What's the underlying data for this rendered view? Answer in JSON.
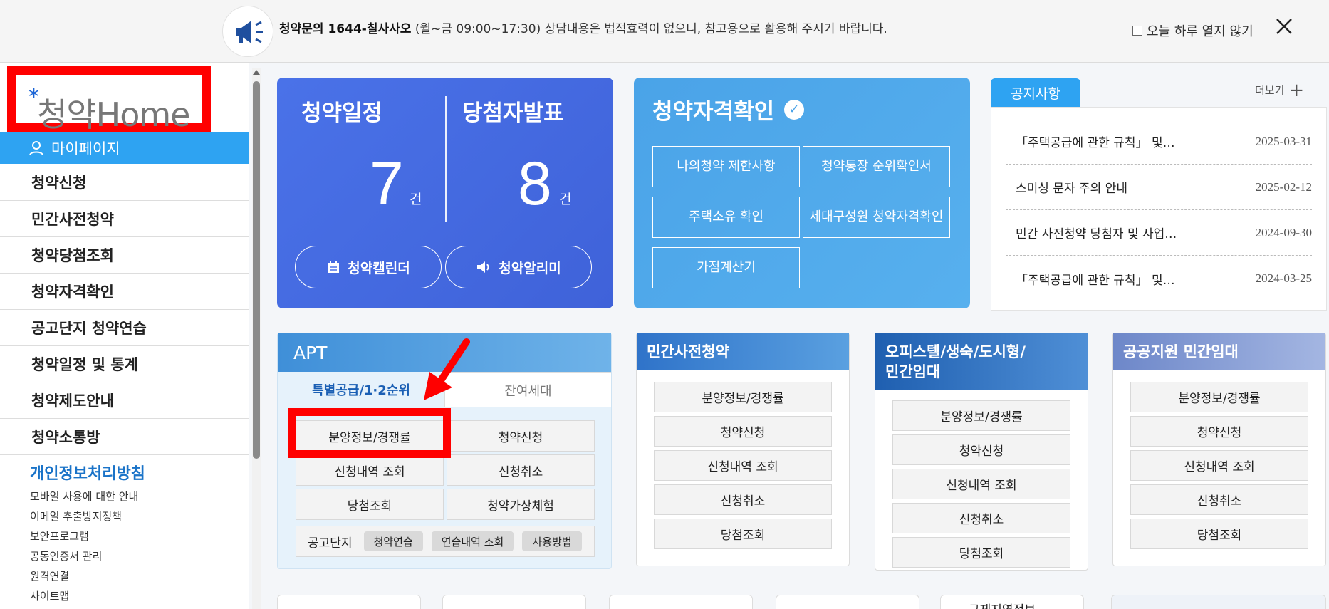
{
  "topbar": {
    "notice_bold": "청약문의 1644-칠사사오",
    "notice_hours": " (월~금 09:00~17:30)",
    "notice_rest": " 상담내용은 법적효력이 없으니, 참고용으로 활용해 주시기 바랍니다.",
    "dont_show_today": "오늘 하루 열지 않기"
  },
  "sidebar": {
    "logo_text": "청약Home",
    "mypage": "마이페이지",
    "menu": [
      "청약신청",
      "민간사전청약",
      "청약당첨조회",
      "청약자격확인",
      "공고단지 청약연습",
      "청약일정 및 통계",
      "청약제도안내",
      "청약소통방"
    ],
    "privacy": "개인정보처리방침",
    "links": [
      "모바일 사용에 대한 안내",
      "이메일 추출방지정책",
      "보안프로그램",
      "공동인증서 관리",
      "원격연결",
      "사이트맵"
    ]
  },
  "schedule": {
    "title_left": "청약일정",
    "title_right": "당첨자발표",
    "count_left": "7",
    "count_right": "8",
    "unit": "건",
    "btn_calendar": "청약캘린더",
    "btn_alarm": "청약알리미"
  },
  "qualification": {
    "title": "청약자격확인",
    "buttons": [
      "나의청약 제한사항",
      "청약통장 순위확인서",
      "주택소유 확인",
      "세대구성원 청약자격확인",
      "가점계산기"
    ]
  },
  "notices": {
    "tab": "공지사항",
    "more": "더보기",
    "items": [
      {
        "title": "「주택공급에 관한 규칙」 및…",
        "date": "2025-03-31"
      },
      {
        "title": "스미싱 문자 주의 안내",
        "date": "2025-02-12"
      },
      {
        "title": "민간 사전청약 당첨자 및 사업…",
        "date": "2024-09-30"
      },
      {
        "title": "「주택공급에 관한 규칙」 및…",
        "date": "2024-03-25"
      }
    ]
  },
  "apt": {
    "title": "APT",
    "tab_active": "특별공급/1·2순위",
    "tab_inactive": "잔여세대",
    "buttons": [
      "분양정보/경쟁률",
      "청약신청",
      "신청내역 조회",
      "신청취소",
      "당첨조회",
      "청약가상체험"
    ],
    "foot_label": "공고단지",
    "foot_chips": [
      "청약연습",
      "연습내역 조회",
      "사용방법"
    ]
  },
  "cards": [
    {
      "title": "민간사전청약",
      "buttons": [
        "분양정보/경쟁률",
        "청약신청",
        "신청내역 조회",
        "신청취소",
        "당첨조회"
      ]
    },
    {
      "title": "오피스텔/생숙/도시형/\n민간임대",
      "buttons": [
        "분양정보/경쟁률",
        "청약신청",
        "신청내역 조회",
        "신청취소",
        "당첨조회"
      ]
    },
    {
      "title": "공공지원 민간임대",
      "buttons": [
        "분양정보/경쟁률",
        "청약신청",
        "신청내역 조회",
        "신청취소",
        "당첨조회"
      ]
    }
  ],
  "bottom": {
    "label": "규제지역정보"
  },
  "colors": {
    "primary": "#4a72e8",
    "sky": "#2ea3f2",
    "highlight": "#ff0000"
  }
}
